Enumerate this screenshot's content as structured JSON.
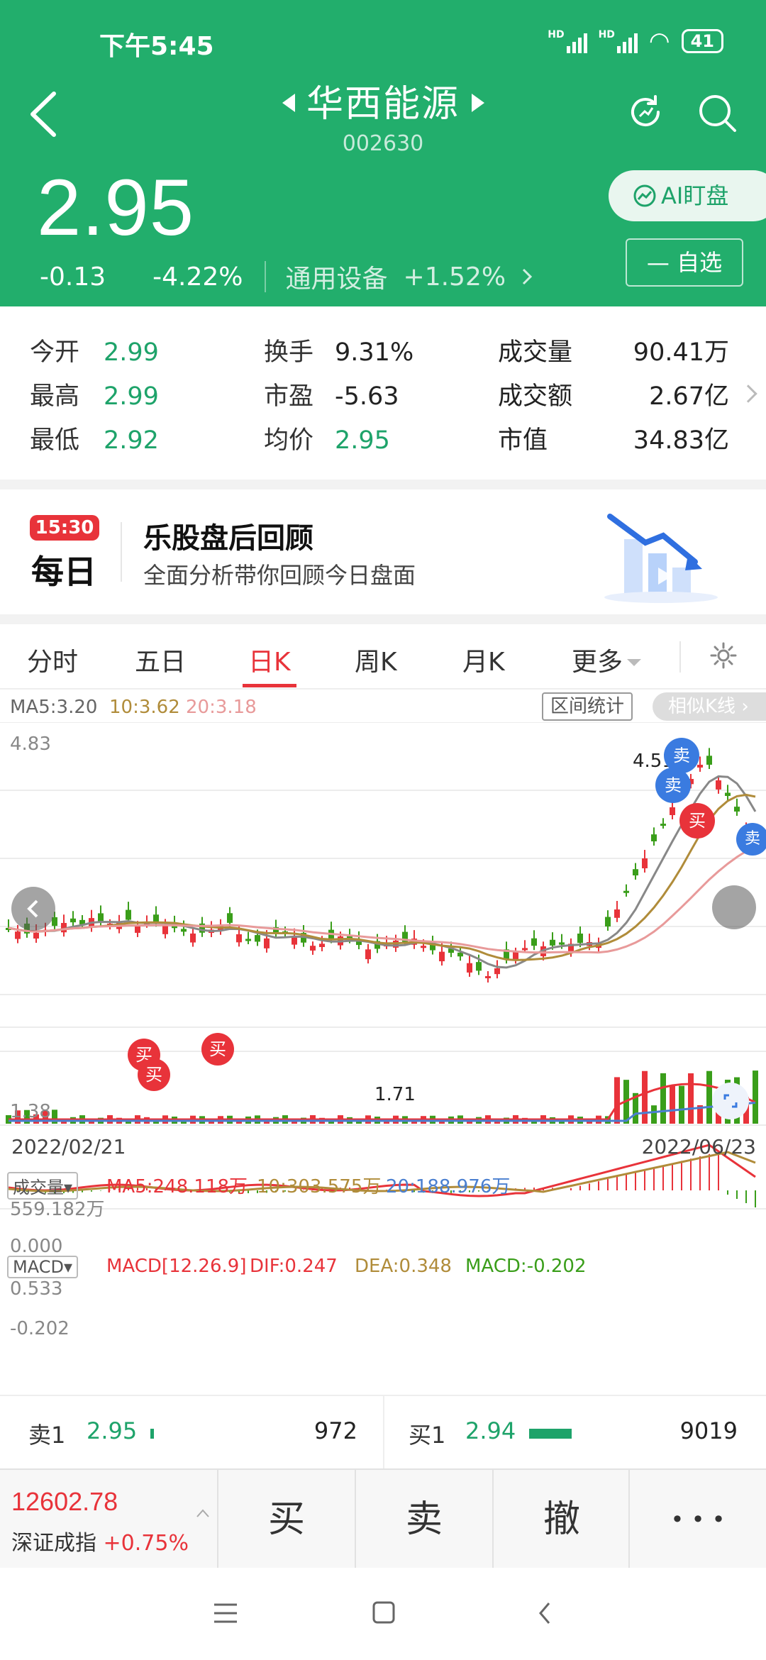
{
  "status_bar": {
    "time": "下午5:45",
    "net1": "HD",
    "net2": "HD",
    "battery": "41"
  },
  "header": {
    "title": "华西能源",
    "code": "002630",
    "price": "2.95",
    "change": "-0.13",
    "change_pct": "-4.22%",
    "industry": "通用设备",
    "industry_pct": "+1.52%",
    "ai_label": "AI盯盘",
    "watch_label": "— 自选"
  },
  "quote": {
    "open_label": "今开",
    "open": "2.99",
    "high_label": "最高",
    "high": "2.99",
    "low_label": "最低",
    "low": "2.92",
    "turnover_label": "换手",
    "turnover": "9.31%",
    "pe_label": "市盈",
    "pe": "-5.63",
    "avg_label": "均价",
    "avg": "2.95",
    "volume_label": "成交量",
    "volume": "90.41万",
    "amount_label": "成交额",
    "amount": "2.67亿",
    "mcap_label": "市值",
    "mcap": "34.83亿"
  },
  "banner": {
    "badge_time": "15:30",
    "badge_day": "每日",
    "title": "乐股盘后回顾",
    "subtitle": "全面分析带你回顾今日盘面"
  },
  "tabs": [
    "分时",
    "五日",
    "日K",
    "周K",
    "月K",
    "更多"
  ],
  "active_tab": "日K",
  "chart": {
    "ma5": "MA5:3.20",
    "ma10": "10:3.62",
    "ma20": "20:3.18",
    "range_stats": "区间统计",
    "similar_k": "相似K线",
    "y_high": "4.83",
    "y_low": "1.38",
    "peak_label": "4.51",
    "trough_label": "1.71",
    "date_start": "2022/02/21",
    "date_end": "2022/06/23",
    "buy": "买",
    "sell": "卖",
    "vol_tab": "成交量",
    "vol_ma5": "MA5:248.118万",
    "vol_ma10": "10:303.575万",
    "vol_ma20": "20:188.976万",
    "vol_max": "559.182万",
    "vol_min": "0.000",
    "macd_tab": "MACD",
    "macd_params": "MACD[12.26.9]",
    "dif": "DIF:0.247",
    "dea": "DEA:0.348",
    "macd_val": "MACD:-0.202",
    "macd_max": "0.533",
    "macd_min": "-0.202",
    "colors": {
      "up": "#e8333a",
      "down": "#3a9e1a",
      "ma5": "#888888",
      "ma10": "#b08c3a",
      "ma20": "#e89a9a"
    }
  },
  "order_book": {
    "sell_label": "卖1",
    "sell_price": "2.95",
    "sell_vol": "972",
    "buy_label": "买1",
    "buy_price": "2.94",
    "buy_vol": "9019"
  },
  "bottom": {
    "index_value": "12602.78",
    "index_name": "深证成指",
    "index_pct": "+0.75%",
    "buy_btn": "买",
    "sell_btn": "卖",
    "cancel_btn": "撤",
    "more_btn": "• • •"
  }
}
